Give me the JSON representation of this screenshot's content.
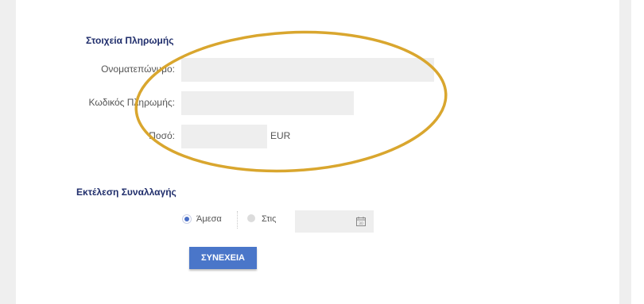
{
  "payment_section": {
    "title": "Στοιχεία Πληρωμής",
    "fullname_label": "Ονοματεπώνυμο:",
    "payment_code_label": "Κωδικός Πληρωμής:",
    "amount_label": "Ποσό:",
    "currency": "EUR"
  },
  "execution_section": {
    "title": "Εκτέλεση Συναλλαγής",
    "option_now": "Άμεσα",
    "option_on": "Στις",
    "selected": "Άμεσα"
  },
  "actions": {
    "continue_label": "ΣΥΝΕΧΕΙΑ"
  },
  "annotation": {
    "ellipse_color": "#d9a62e"
  },
  "colors": {
    "title": "#1f2d6b",
    "button": "#4a76c9",
    "field_bg": "#eeeeee"
  }
}
